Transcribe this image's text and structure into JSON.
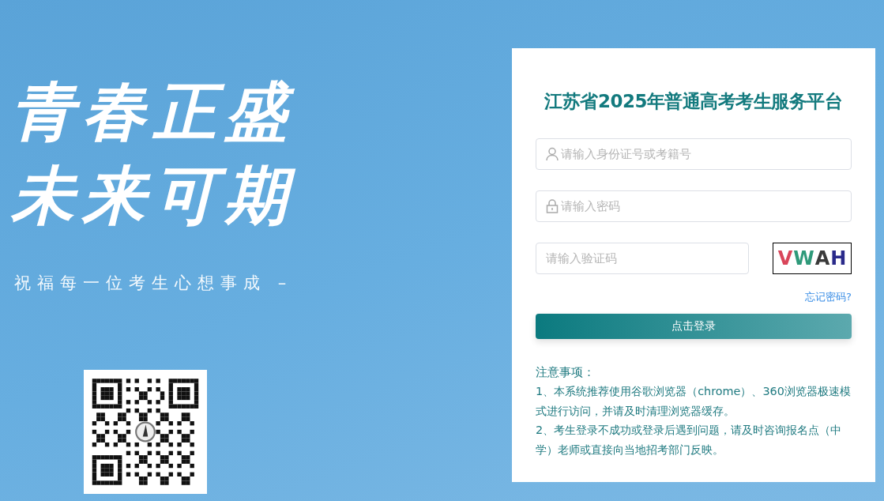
{
  "slogan": {
    "lines": [
      "青春正盛",
      "未来可期"
    ],
    "subtitle": "祝福每一位考生心想事成 –"
  },
  "login": {
    "title": "江苏省2025年普通高考考生服务平台",
    "fields": [
      {
        "kind": "user",
        "placeholder": "请输入身份证号或考籍号"
      },
      {
        "kind": "password",
        "placeholder": "请输入密码"
      },
      {
        "kind": "captcha",
        "placeholder": "请输入验证码"
      }
    ],
    "captcha": [
      {
        "char": "V",
        "color": "#d9465a"
      },
      {
        "char": "W",
        "color": "#2f9a7a"
      },
      {
        "char": "A",
        "color": "#3a3a3a"
      },
      {
        "char": "H",
        "color": "#2a2a8a"
      }
    ],
    "forgot_link": "忘记密码?",
    "submit": "点击登录",
    "notes_title": "注意事项：",
    "notes": [
      "1、本系统推荐使用谷歌浏览器（chrome）、360浏览器极速模式进行访问，并请及时清理浏览器缓存。",
      "2、考生登录不成功或登录后遇到问题，请及时咨询报名点（中学）老师或直接向当地招考部门反映。"
    ]
  }
}
